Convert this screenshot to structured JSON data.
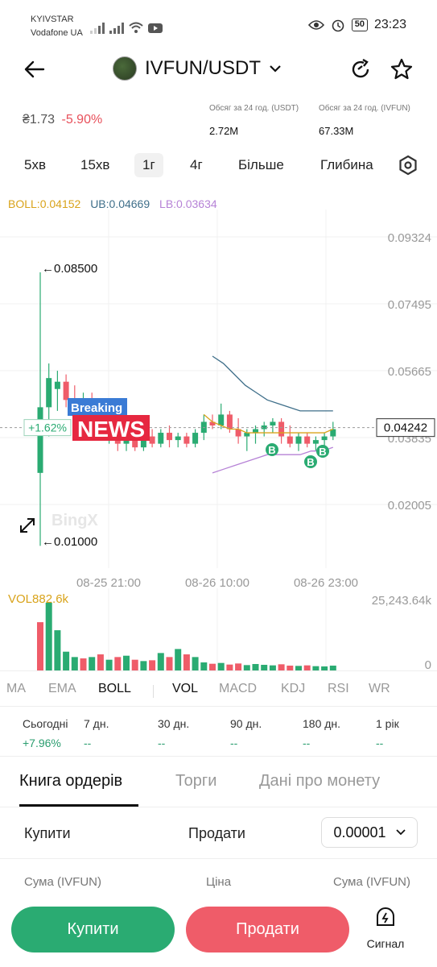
{
  "status": {
    "carrier1": "KYIVSTAR",
    "carrier2": "Vodafone UA",
    "battery": "50",
    "time": "23:23"
  },
  "header": {
    "pair": "IVFUN/USDT"
  },
  "price": {
    "value": "₴1.73",
    "change": "-5.90%",
    "vol_usdt_label": "Обсяг за 24 год. (USDT)",
    "vol_usdt": "2.72M",
    "vol_ivfun_label": "Обсяг за 24 год. (IVFUN)",
    "vol_ivfun": "67.33M"
  },
  "timeframes": {
    "items": [
      "5хв",
      "15хв",
      "1г",
      "4г",
      "Більше",
      "Глибина"
    ],
    "active": "1г"
  },
  "indicators": {
    "boll": "BOLL:0.04152",
    "ub": "UB:0.04669",
    "lb": "LB:0.03634"
  },
  "chart_data": {
    "type": "candlestick",
    "y_ticks": [
      "0.09324",
      "0.07495",
      "0.05665",
      "0.03835",
      "0.02005"
    ],
    "x_ticks": [
      "08-25 21:00",
      "08-26 10:00",
      "08-26 23:00"
    ],
    "ylim": [
      0.005,
      0.1
    ],
    "high_label": "←0.08500",
    "low_label": "←0.01000",
    "current_price": "0.04242",
    "change_badge": "+1.62%",
    "news_badge_top": "Breaking",
    "news_badge_bottom": "NEWS",
    "watermark": "BingX",
    "marker_label": "B",
    "candles": [
      {
        "o": 0.03,
        "h": 0.085,
        "l": 0.01,
        "c": 0.048
      },
      {
        "o": 0.048,
        "h": 0.06,
        "l": 0.04,
        "c": 0.056
      },
      {
        "o": 0.053,
        "h": 0.058,
        "l": 0.047,
        "c": 0.055
      },
      {
        "o": 0.055,
        "h": 0.057,
        "l": 0.048,
        "c": 0.05
      },
      {
        "o": 0.05,
        "h": 0.054,
        "l": 0.044,
        "c": 0.046
      },
      {
        "o": 0.046,
        "h": 0.052,
        "l": 0.042,
        "c": 0.05
      },
      {
        "o": 0.05,
        "h": 0.052,
        "l": 0.042,
        "c": 0.044
      },
      {
        "o": 0.044,
        "h": 0.048,
        "l": 0.039,
        "c": 0.041
      },
      {
        "o": 0.041,
        "h": 0.045,
        "l": 0.038,
        "c": 0.043
      },
      {
        "o": 0.043,
        "h": 0.044,
        "l": 0.036,
        "c": 0.038
      },
      {
        "o": 0.038,
        "h": 0.042,
        "l": 0.036,
        "c": 0.041
      },
      {
        "o": 0.041,
        "h": 0.042,
        "l": 0.036,
        "c": 0.037
      },
      {
        "o": 0.037,
        "h": 0.041,
        "l": 0.036,
        "c": 0.04
      },
      {
        "o": 0.04,
        "h": 0.042,
        "l": 0.037,
        "c": 0.038
      },
      {
        "o": 0.038,
        "h": 0.042,
        "l": 0.037,
        "c": 0.041
      },
      {
        "o": 0.041,
        "h": 0.043,
        "l": 0.037,
        "c": 0.039
      },
      {
        "o": 0.039,
        "h": 0.041,
        "l": 0.037,
        "c": 0.04
      },
      {
        "o": 0.04,
        "h": 0.041,
        "l": 0.037,
        "c": 0.038
      },
      {
        "o": 0.038,
        "h": 0.042,
        "l": 0.037,
        "c": 0.041
      },
      {
        "o": 0.041,
        "h": 0.046,
        "l": 0.039,
        "c": 0.044
      },
      {
        "o": 0.044,
        "h": 0.046,
        "l": 0.042,
        "c": 0.043
      },
      {
        "o": 0.043,
        "h": 0.049,
        "l": 0.042,
        "c": 0.046
      },
      {
        "o": 0.046,
        "h": 0.047,
        "l": 0.041,
        "c": 0.042
      },
      {
        "o": 0.042,
        "h": 0.045,
        "l": 0.038,
        "c": 0.04
      },
      {
        "o": 0.04,
        "h": 0.042,
        "l": 0.036,
        "c": 0.041
      },
      {
        "o": 0.041,
        "h": 0.043,
        "l": 0.038,
        "c": 0.042
      },
      {
        "o": 0.042,
        "h": 0.044,
        "l": 0.04,
        "c": 0.043
      },
      {
        "o": 0.043,
        "h": 0.045,
        "l": 0.041,
        "c": 0.044
      },
      {
        "o": 0.044,
        "h": 0.045,
        "l": 0.038,
        "c": 0.04
      },
      {
        "o": 0.04,
        "h": 0.043,
        "l": 0.037,
        "c": 0.038
      },
      {
        "o": 0.038,
        "h": 0.041,
        "l": 0.036,
        "c": 0.04
      },
      {
        "o": 0.04,
        "h": 0.041,
        "l": 0.037,
        "c": 0.038
      },
      {
        "o": 0.038,
        "h": 0.04,
        "l": 0.036,
        "c": 0.039
      },
      {
        "o": 0.039,
        "h": 0.041,
        "l": 0.037,
        "c": 0.04
      },
      {
        "o": 0.04,
        "h": 0.044,
        "l": 0.039,
        "c": 0.042
      }
    ],
    "ub_line": [
      0.062,
      0.06,
      0.057,
      0.054,
      0.052,
      0.05,
      0.049,
      0.048,
      0.047,
      0.047,
      0.047,
      0.047
    ],
    "mid_line": [
      0.046,
      0.044,
      0.043,
      0.042,
      0.042,
      0.041,
      0.041,
      0.041,
      0.041,
      0.041,
      0.041,
      0.041,
      0.041,
      0.041,
      0.041,
      0.042
    ],
    "lb_line": [
      0.03,
      0.031,
      0.032,
      0.033,
      0.034,
      0.035,
      0.035,
      0.035,
      0.035,
      0.036,
      0.036,
      0.037
    ]
  },
  "volume": {
    "label": "VOL882.6k",
    "max_label": "25,243.64k",
    "zero_label": "0",
    "ymax": 25243.64,
    "values": [
      18000,
      25243,
      15000,
      7000,
      5000,
      4500,
      5000,
      6000,
      4000,
      5000,
      5500,
      4000,
      3500,
      3800,
      6500,
      5000,
      8000,
      6000,
      5000,
      3000,
      2500,
      2800,
      2200,
      2600,
      2000,
      2400,
      2100,
      1900,
      2300,
      1800,
      1700,
      1900,
      1600,
      1500,
      1800
    ],
    "up": [
      false,
      true,
      true,
      true,
      true,
      false,
      true,
      false,
      true,
      false,
      true,
      false,
      true,
      false,
      true,
      false,
      true,
      false,
      true,
      true,
      false,
      true,
      false,
      false,
      true,
      true,
      true,
      true,
      false,
      false,
      true,
      false,
      true,
      true,
      true
    ]
  },
  "indicator_tabs": {
    "main": [
      "MA",
      "EMA",
      "BOLL"
    ],
    "sub": [
      "VOL",
      "MACD",
      "KDJ",
      "RSI",
      "WR"
    ],
    "main_active": "BOLL",
    "sub_active": "VOL"
  },
  "performance": {
    "labels": [
      "Сьогодні",
      "7 дн.",
      "30 дн.",
      "90 дн.",
      "180 дн.",
      "1 рік"
    ],
    "values": [
      "+7.96%",
      "--",
      "--",
      "--",
      "--",
      "--"
    ]
  },
  "book": {
    "tabs": [
      "Книга ордерів",
      "Торги",
      "Дані про монету"
    ],
    "active": "Книга ордерів",
    "buy_label": "Купити",
    "sell_label": "Продати",
    "precision": "0.00001",
    "col_amount_left": "Сума (IVFUN)",
    "col_price": "Ціна",
    "col_amount_right": "Сума (IVFUN)"
  },
  "actions": {
    "buy": "Купити",
    "sell": "Продати",
    "signal": "Сигнал"
  },
  "colors": {
    "up": "#2aab72",
    "down": "#ef5c69",
    "boll_mid": "#d9a31a",
    "ub": "#3f6f8a",
    "lb": "#b682d6"
  }
}
